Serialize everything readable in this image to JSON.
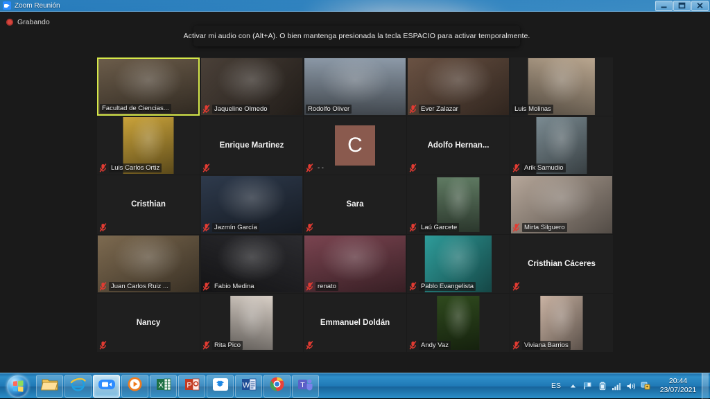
{
  "window": {
    "title": "Zoom Reunión",
    "app_icon": "zoom-icon",
    "minimize_label": "Minimizar",
    "maximize_label": "Restaurar",
    "close_label": "Cerrar"
  },
  "app": {
    "recording": {
      "icon": "record-dot-icon",
      "label": "Grabando"
    },
    "tooltip": {
      "text": "Activar mi audio con (Alt+A). O bien mantenga presionada la tecla ESPACIO para activar temporalmente."
    },
    "active_speaker_color": "#d6e84a",
    "muted_icon_color": "#e23b32",
    "grid": {
      "columns": 5,
      "rows": 5,
      "participants": [
        {
          "name": "Facultad de Ciencias...",
          "muted": false,
          "video": true,
          "active_speaker": true,
          "media": "video-fill",
          "tone": "#6b5c4a"
        },
        {
          "name": "Jaqueline Olmedo",
          "muted": true,
          "video": true,
          "active_speaker": false,
          "media": "video-fill",
          "tone": "#4a4038"
        },
        {
          "name": "Rodolfo Oliver",
          "muted": false,
          "video": true,
          "active_speaker": false,
          "media": "video-fill",
          "tone": "#8d9aa8"
        },
        {
          "name": "Ever Zalazar",
          "muted": true,
          "video": true,
          "active_speaker": false,
          "media": "video-fill",
          "tone": "#6a5243"
        },
        {
          "name": "Luis Molinas",
          "muted": false,
          "video": true,
          "active_speaker": false,
          "media": "video-inset-wide",
          "tone": "#b9a68f"
        },
        {
          "name": "Luis Carlos Ortiz",
          "muted": true,
          "video": true,
          "active_speaker": false,
          "media": "video-inset",
          "tone": "#caa33a"
        },
        {
          "name": "Enrique Martinez",
          "muted": true,
          "video": false,
          "active_speaker": false,
          "media": "name-only",
          "tone": "#1f1f1f"
        },
        {
          "name": "- -",
          "muted": true,
          "video": false,
          "active_speaker": false,
          "media": "avatar-letter",
          "avatar_letter": "C",
          "tone": "#8a5a4e"
        },
        {
          "name": "Adolfo  Hernan...",
          "muted": true,
          "video": false,
          "active_speaker": false,
          "media": "name-only",
          "tone": "#1f1f1f"
        },
        {
          "name": "Arik Samudio",
          "muted": true,
          "video": true,
          "active_speaker": false,
          "media": "video-inset",
          "tone": "#7b8b92"
        },
        {
          "name": "Cristhian",
          "muted": true,
          "video": false,
          "active_speaker": false,
          "media": "name-only",
          "tone": "#1f1f1f"
        },
        {
          "name": "Jazmín García",
          "muted": true,
          "video": true,
          "active_speaker": false,
          "media": "video-fill",
          "tone": "#2e3a4c"
        },
        {
          "name": "Sara",
          "muted": true,
          "video": false,
          "active_speaker": false,
          "media": "name-only",
          "tone": "#1f1f1f"
        },
        {
          "name": "Laú Garcete",
          "muted": true,
          "video": true,
          "active_speaker": false,
          "media": "video-inset-narrow",
          "tone": "#5f7a62"
        },
        {
          "name": "Mirta Silguero",
          "muted": true,
          "video": true,
          "active_speaker": false,
          "media": "video-fill",
          "tone": "#b6a79a"
        },
        {
          "name": "Juan Carlos Ruiz ...",
          "muted": true,
          "video": true,
          "active_speaker": false,
          "media": "video-fill",
          "tone": "#7d6a50"
        },
        {
          "name": "Fabio Medina",
          "muted": true,
          "video": true,
          "active_speaker": false,
          "media": "video-fill",
          "tone": "#2b2b2f"
        },
        {
          "name": "renato",
          "muted": true,
          "video": true,
          "active_speaker": false,
          "media": "video-fill",
          "tone": "#7a4450"
        },
        {
          "name": "Pablo Evangelista",
          "muted": true,
          "video": true,
          "active_speaker": false,
          "media": "video-inset-wide",
          "tone": "#2e9c9a"
        },
        {
          "name": "Cristhian Cáceres",
          "muted": true,
          "video": false,
          "active_speaker": false,
          "media": "name-only",
          "tone": "#1f1f1f"
        },
        {
          "name": "Nancy",
          "muted": true,
          "video": false,
          "active_speaker": false,
          "media": "name-only",
          "tone": "#1f1f1f"
        },
        {
          "name": "Rita Pico",
          "muted": true,
          "video": true,
          "active_speaker": false,
          "media": "video-inset-narrow",
          "tone": "#d8cfc6"
        },
        {
          "name": "Emmanuel Doldán",
          "muted": true,
          "video": false,
          "active_speaker": false,
          "media": "name-only",
          "tone": "#1f1f1f"
        },
        {
          "name": "Andy Vaz",
          "muted": true,
          "video": true,
          "active_speaker": false,
          "media": "video-inset-narrow",
          "tone": "#2f4a1e"
        },
        {
          "name": "Viviana Barrios",
          "muted": true,
          "video": true,
          "active_speaker": false,
          "media": "video-inset-narrow",
          "tone": "#cbb4a4"
        }
      ]
    }
  },
  "taskbar": {
    "start_label": "Inicio",
    "buttons": [
      {
        "name": "file-explorer",
        "label": "Explorador de Windows",
        "state": "pinned"
      },
      {
        "name": "internet-explorer",
        "label": "Internet Explorer",
        "state": "pinned"
      },
      {
        "name": "zoom",
        "label": "Zoom Reunión",
        "state": "active"
      },
      {
        "name": "media-player",
        "label": "Reproductor multimedia",
        "state": "pinned"
      },
      {
        "name": "excel",
        "label": "Excel",
        "state": "pinned"
      },
      {
        "name": "powerpoint",
        "label": "PowerPoint",
        "state": "pinned"
      },
      {
        "name": "dropbox",
        "label": "Dropbox",
        "state": "pinned"
      },
      {
        "name": "word",
        "label": "Word",
        "state": "pinned"
      },
      {
        "name": "chrome",
        "label": "Google Chrome",
        "state": "pinned"
      },
      {
        "name": "teams",
        "label": "Microsoft Teams",
        "state": "pinned"
      }
    ],
    "tray": {
      "language": "ES",
      "icons": [
        "show-hidden-icons",
        "action-center-flag-icon",
        "battery-icon",
        "network-signal-icon",
        "volume-icon",
        "security-shield-icon"
      ],
      "time": "20:44",
      "date": "23/07/2021"
    }
  }
}
